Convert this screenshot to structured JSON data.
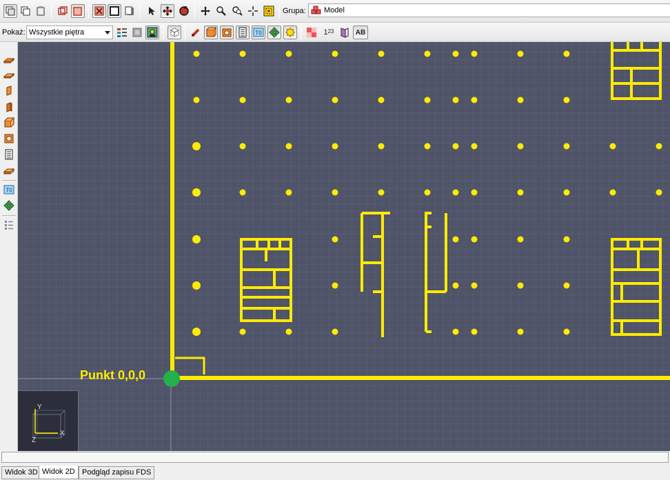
{
  "toolbar_top": {
    "buttons": [
      {
        "name": "new-copy-icon"
      },
      {
        "name": "copy-icon"
      },
      {
        "name": "paste-icon"
      },
      {
        "name": "box-red-icon"
      },
      {
        "name": "box-red-filled-icon"
      },
      {
        "name": "delete-box-icon"
      },
      {
        "name": "box-outline-icon"
      },
      {
        "name": "box-shadow-icon"
      },
      {
        "name": "select-arrow-icon"
      },
      {
        "name": "move-object-icon"
      },
      {
        "name": "rotate-icon"
      },
      {
        "name": "pan-icon"
      },
      {
        "name": "zoom-icon"
      },
      {
        "name": "zoom-window-icon"
      },
      {
        "name": "crosshair-icon"
      },
      {
        "name": "fit-view-icon"
      }
    ],
    "group_label": "Grupa:",
    "group_value": "Model"
  },
  "toolbar_second": {
    "show_label": "Pokaż:",
    "floor_select_value": "Wszystkie piętra",
    "ordinal_text": "1",
    "superscript_text": "23",
    "ab_button_text": "AB"
  },
  "left_tools": {
    "buttons": [
      {
        "name": "slab-tool-icon"
      },
      {
        "name": "slab-alt-tool-icon"
      },
      {
        "name": "wall-tool-icon"
      },
      {
        "name": "wall-alt-tool-icon"
      },
      {
        "name": "block-tool-icon"
      },
      {
        "name": "hole-tool-icon"
      },
      {
        "name": "stairs-tool-icon"
      },
      {
        "name": "vent-tool-icon"
      },
      {
        "name": "text-tool-icon"
      },
      {
        "name": "device-tool-icon"
      },
      {
        "name": "properties-tool-icon"
      }
    ],
    "text_tool_label": "T0"
  },
  "viewport": {
    "origin_label": "Punkt 0,0,0",
    "axis_x_label": "X",
    "axis_y_label": "Y",
    "axis_z_label": "Z",
    "colors": {
      "background": "#4f5468",
      "grid": "#6a6f85",
      "geometry": "#ffeb00",
      "origin_marker": "#22b14c"
    }
  },
  "tabs": [
    {
      "label": "Widok 3D",
      "active": false
    },
    {
      "label": "Widok 2D",
      "active": true
    },
    {
      "label": "Podgląd zapisu FDS",
      "active": false
    }
  ]
}
